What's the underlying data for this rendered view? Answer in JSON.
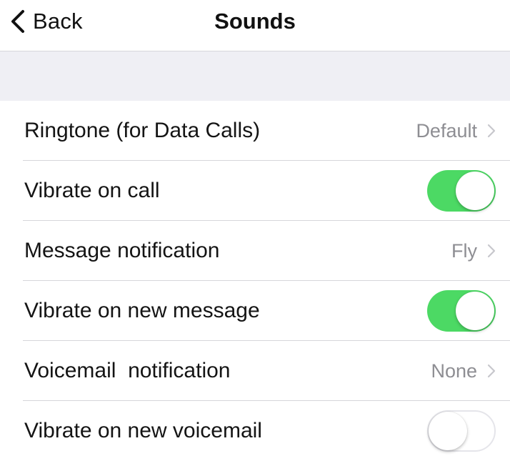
{
  "nav": {
    "back_label": "Back",
    "title": "Sounds"
  },
  "colors": {
    "toggle_on": "#4cd964",
    "separator": "#d6d6da",
    "group_background": "#efeff4",
    "value_text": "#8e8e93"
  },
  "rows": [
    {
      "label": "Ringtone (for Data Calls)",
      "type": "disclosure",
      "value": "Default",
      "icon": "chevron-right-icon"
    },
    {
      "label": "Vibrate on call",
      "type": "toggle",
      "on": true
    },
    {
      "label": "Message notification",
      "type": "disclosure",
      "value": "Fly",
      "icon": "chevron-right-icon"
    },
    {
      "label": "Vibrate on new message",
      "type": "toggle",
      "on": true
    },
    {
      "label": "Voicemail  notification",
      "type": "disclosure",
      "value": "None",
      "icon": "chevron-right-icon"
    },
    {
      "label": "Vibrate on new voicemail",
      "type": "toggle",
      "on": false
    }
  ]
}
